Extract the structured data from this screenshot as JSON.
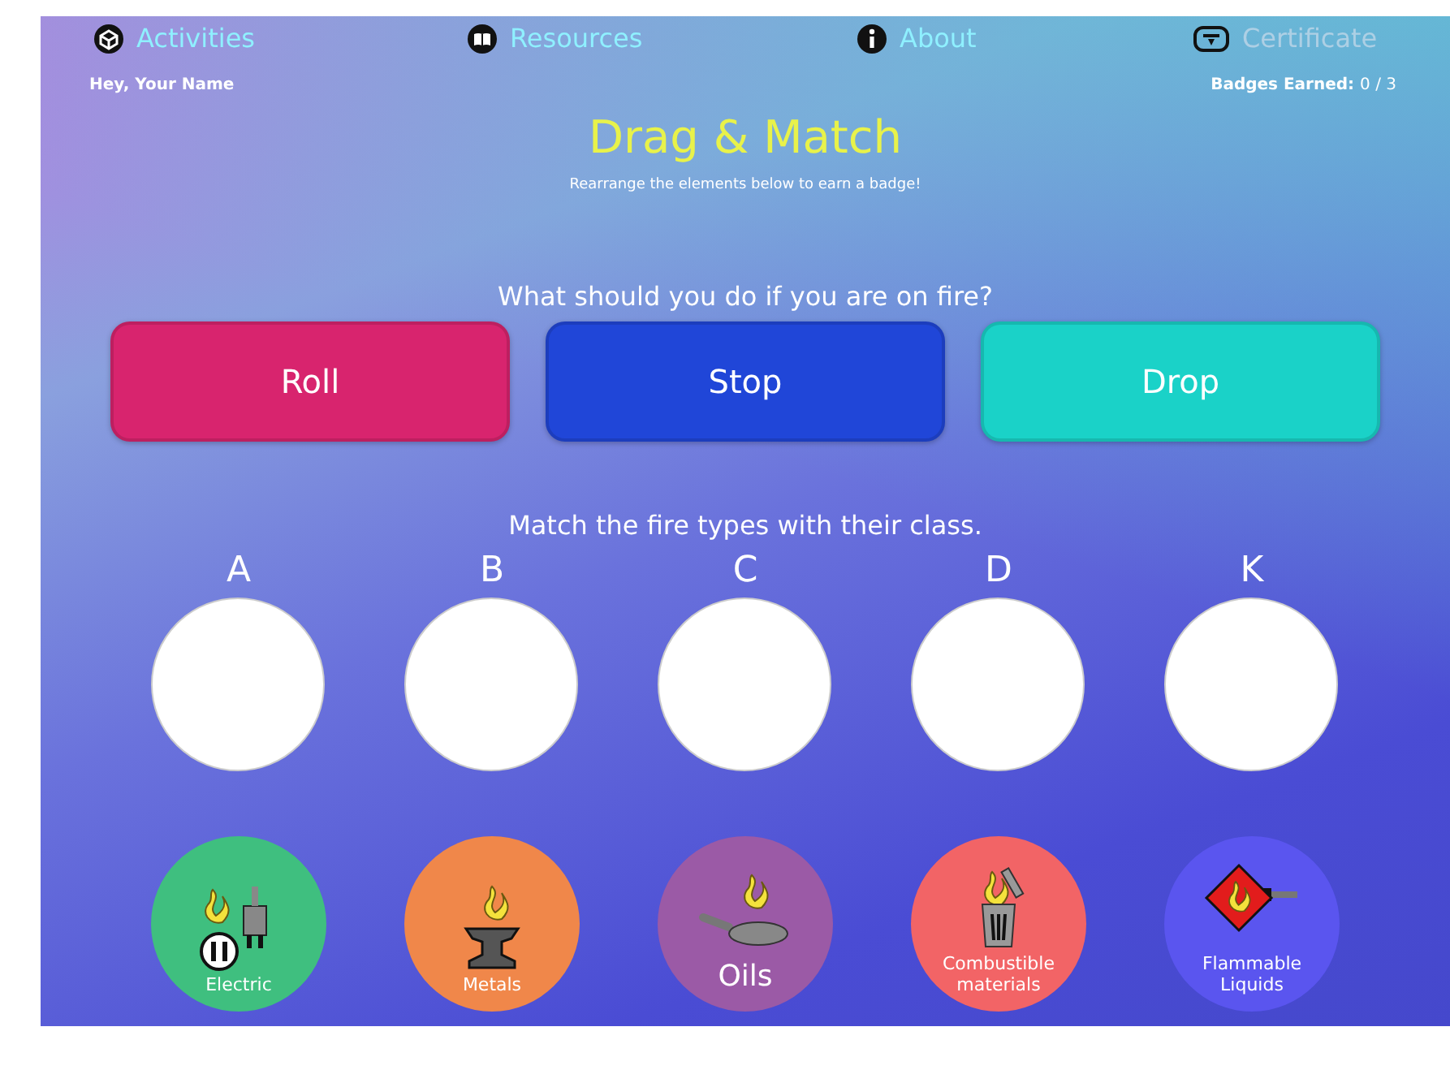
{
  "nav": [
    {
      "label": "Activities",
      "kind": "cube",
      "disabled": false
    },
    {
      "label": "Resources",
      "kind": "book",
      "disabled": false
    },
    {
      "label": "About",
      "kind": "info",
      "disabled": false
    },
    {
      "label": "Certificate",
      "kind": "certificate",
      "disabled": true
    }
  ],
  "greeting": "Hey, Your Name",
  "badges": {
    "label": "Badges Earned:",
    "value": "0 / 3"
  },
  "title": "Drag & Match",
  "subtitle": "Rearrange the elements below to earn a badge!",
  "question": "What should you do if you are on fire?",
  "answers": [
    {
      "label": "Roll",
      "color": "#d8246e"
    },
    {
      "label": "Stop",
      "color": "#2046d8"
    },
    {
      "label": "Drop",
      "color": "#1ad2c8"
    }
  ],
  "match_prompt": "Match the fire types with their class.",
  "classes": [
    "A",
    "B",
    "C",
    "D",
    "K"
  ],
  "fire_types": [
    {
      "label": "Electric",
      "kind": "electric",
      "color": "#3fbf7f"
    },
    {
      "label": "Metals",
      "kind": "metals",
      "color": "#f0874a"
    },
    {
      "label": "Oils",
      "kind": "oils",
      "color": "#9b5aa6"
    },
    {
      "label": "Combustible materials",
      "kind": "combustible",
      "color": "#f26466"
    },
    {
      "label": "Flammable Liquids",
      "kind": "flammable",
      "color": "#5a55ef"
    }
  ]
}
